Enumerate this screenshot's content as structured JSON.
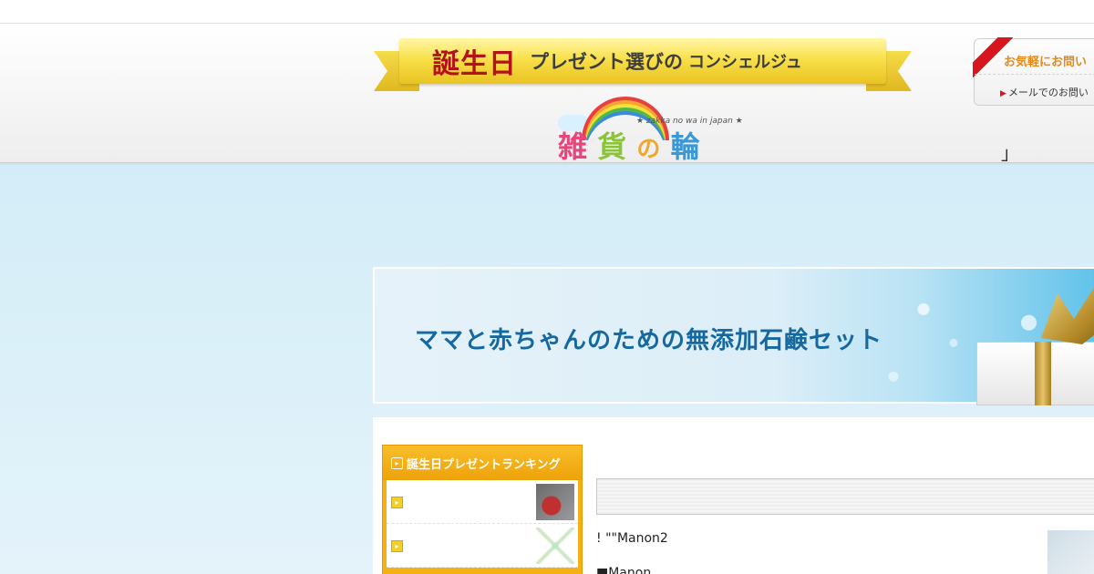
{
  "header": {
    "ribbon": {
      "big": "誕生日",
      "mid": "プレゼント選びの",
      "small": "コンシェルジュ"
    },
    "logo": {
      "tagline": "★ zakka no wa in japan ★",
      "chars": [
        "雑",
        "貨",
        "の",
        "輪"
      ]
    },
    "contact": {
      "title": "お気軽にお問い",
      "mail_label": "メールでのお問い"
    },
    "bracket": "」"
  },
  "banner": {
    "title": "ママと赤ちゃんのための無添加石鹸セット"
  },
  "ranking": {
    "title": "誕生日プレゼントランキング",
    "items": [
      {
        "thumb": "red-bag-thumbnail"
      },
      {
        "thumb": "star-ornament-thumbnail"
      }
    ]
  },
  "main": {
    "line1": "! \"\"Manon2",
    "line2": "■Manon"
  },
  "colors": {
    "ribbon_red": "#b3121b",
    "ribbon_gold": "#f8e04a",
    "banner_text": "#1669a0",
    "ranking_orange": "#f5b016",
    "contact_accent": "#e58a1a"
  }
}
